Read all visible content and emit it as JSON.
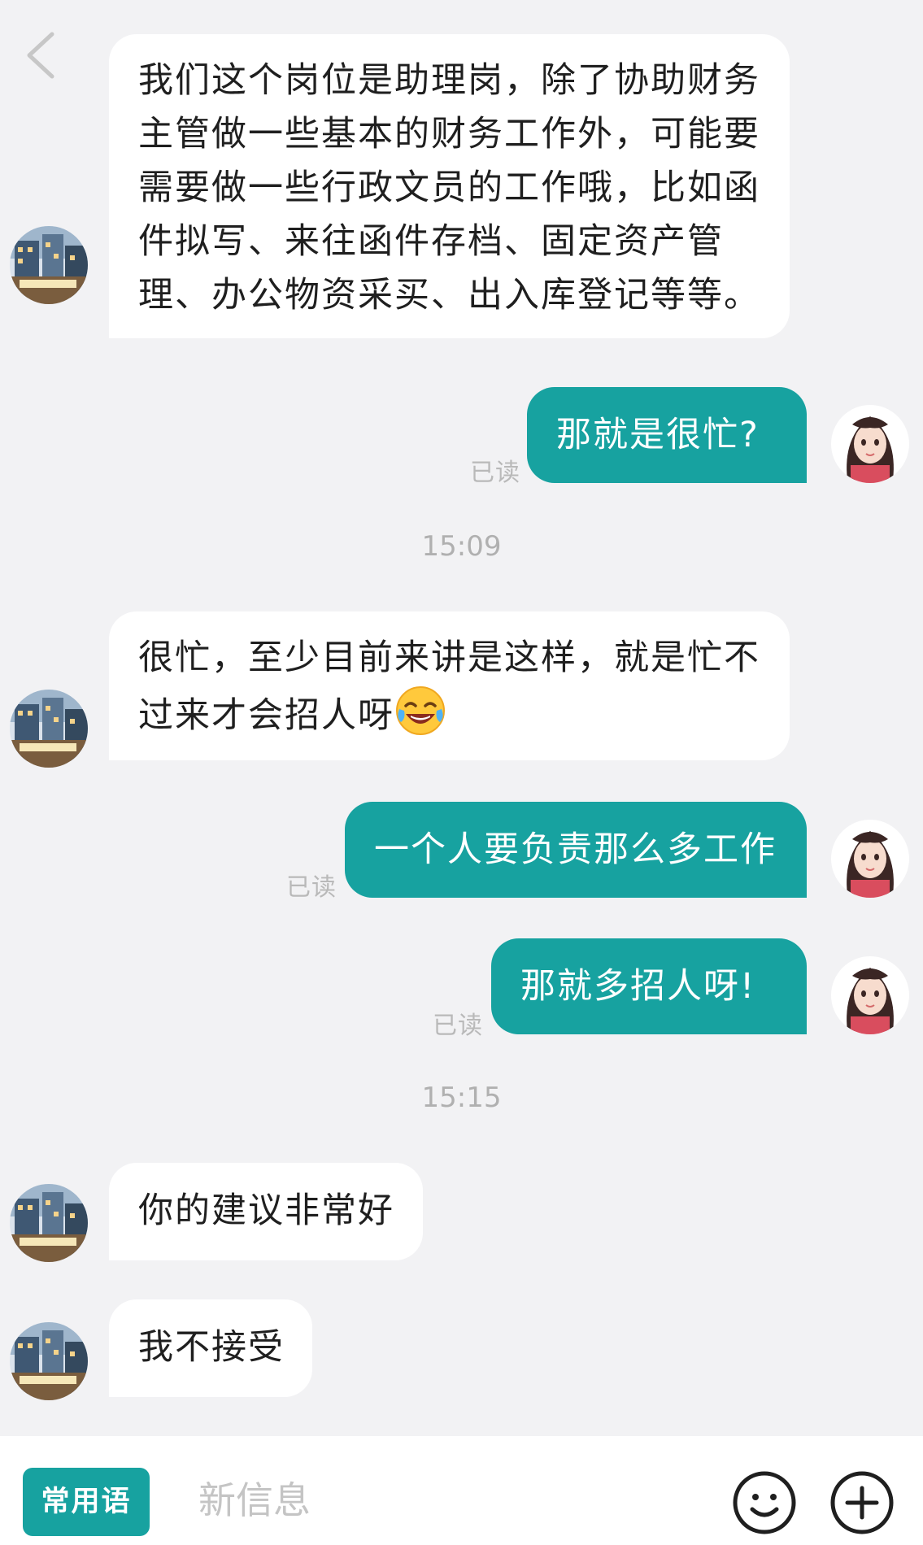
{
  "nav": {
    "back_icon": "chevron-left-icon"
  },
  "messages": [
    {
      "sender": "contact",
      "text": "我们这个岗位是助理岗，除了协助财务主管做一些基本的财务工作外，可能要需要做一些行政文员的工作哦，比如函件拟写、来往函件存档、固定资产管理、办公物资采买、出入库登记等等。"
    },
    {
      "sender": "me",
      "text": "那就是很忙?",
      "status": "已读"
    },
    {
      "type": "timestamp",
      "text": "15:09"
    },
    {
      "sender": "contact",
      "text": "很忙，至少目前来讲是这样，就是忙不过来才会招人呀",
      "emoji": "face-with-tears-of-joy-icon"
    },
    {
      "sender": "me",
      "text": "一个人要负责那么多工作",
      "status": "已读"
    },
    {
      "sender": "me",
      "text": "那就多招人呀!",
      "status": "已读"
    },
    {
      "type": "timestamp",
      "text": "15:15"
    },
    {
      "sender": "contact",
      "text": "你的建议非常好"
    },
    {
      "sender": "contact",
      "text": "我不接受"
    }
  ],
  "input_bar": {
    "phrases_label": "常用语",
    "placeholder": "新信息",
    "emoji_icon": "smiley-icon",
    "plus_icon": "plus-icon"
  },
  "colors": {
    "accent": "#17a2a0",
    "background": "#f2f2f4",
    "incoming_bubble": "#ffffff",
    "read_status": "#b9b9b9"
  }
}
